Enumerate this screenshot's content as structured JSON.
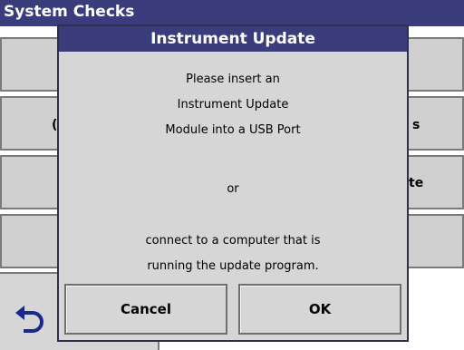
{
  "window": {
    "title": "System Checks"
  },
  "background": {
    "fragments": [
      "s",
      "te"
    ]
  },
  "dialog": {
    "title": "Instrument Update",
    "message_lines": [
      "Please insert an",
      "Instrument Update",
      "Module into a USB Port",
      "or",
      "connect to a computer that is",
      "running the update program."
    ],
    "cancel_label": "Cancel",
    "ok_label": "OK"
  },
  "icons": {
    "back": "back-arrow-icon"
  }
}
